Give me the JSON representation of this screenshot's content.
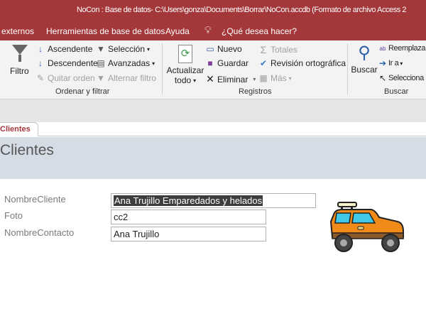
{
  "window": {
    "title": "NoCon : Base de datos- C:\\Users\\gonza\\Documents\\Borrar\\NoCon.accdb (Formato de archivo Access 2"
  },
  "menu": {
    "items": [
      "externos",
      "Herramientas de base de datos",
      "Ayuda"
    ],
    "tell_me": "¿Qué desea hacer?"
  },
  "ribbon": {
    "sort_filter": {
      "label": "Ordenar y filtrar",
      "filtro": "Filtro",
      "ascendente": "Ascendente",
      "descendente": "Descendente",
      "quitar_orden": "Quitar orden",
      "seleccion": "Selección",
      "avanzadas": "Avanzadas",
      "alternar_filtro": "Alternar filtro"
    },
    "records": {
      "label": "Registros",
      "actualizar": "Actualizar",
      "todo": "todo",
      "nuevo": "Nuevo",
      "guardar": "Guardar",
      "eliminar": "Eliminar",
      "totales": "Totales",
      "revision": "Revisión ortográfica",
      "mas": "Más"
    },
    "find": {
      "label": "Buscar",
      "buscar": "Buscar",
      "reemplazar": "Reemplaza",
      "ir_a": "Ir a",
      "seleccionar": "Selecciona"
    }
  },
  "tab": {
    "label": "Clientes"
  },
  "form": {
    "title": "Clientes",
    "fields": [
      {
        "label": "NombreCliente",
        "value": "Ana Trujillo Emparedados y helados"
      },
      {
        "label": "Foto",
        "value": "cc2"
      },
      {
        "label": "NombreContacto",
        "value": "Ana Trujillo"
      }
    ]
  },
  "colors": {
    "accent": "#a4373a",
    "header": "#d6dce5"
  }
}
